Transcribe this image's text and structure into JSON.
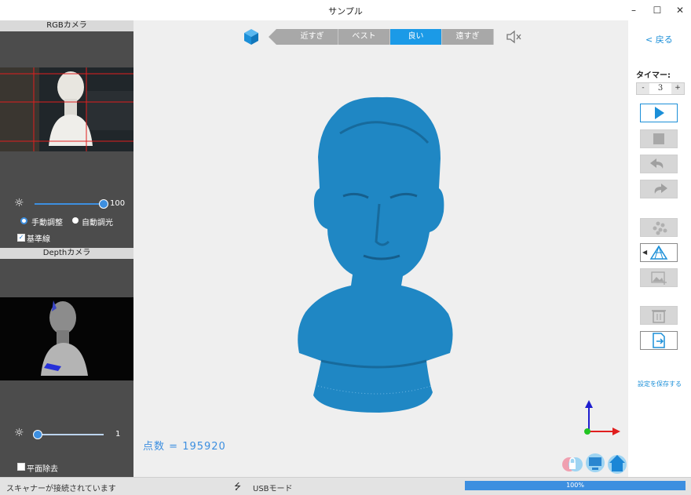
{
  "window": {
    "title": "サンプル",
    "minimize": "–",
    "maximize": "☐",
    "close": "✕"
  },
  "left_panel": {
    "rgb_camera": {
      "header": "RGBカメラ",
      "brightness_value": "100",
      "brightness_fraction": 1.0,
      "manual_adjust_label": "手動調整",
      "auto_light_label": "自動調光",
      "reference_lines_label": "基準線",
      "reference_lines_checked": true
    },
    "depth_camera": {
      "header": "Depthカメラ",
      "brightness_value": "1",
      "brightness_fraction": 0.0,
      "plane_removal_label": "平面除去",
      "plane_removal_checked": false
    }
  },
  "quality_bar": {
    "segments": [
      "近すぎ",
      "ベスト",
      "良い",
      "遠すぎ"
    ],
    "active_index": 2
  },
  "viewport": {
    "point_count_label": "点数",
    "point_count_eq": "=",
    "point_count_value": "195920"
  },
  "right_panel": {
    "back_label": "< 戻る",
    "timer_label": "タイマー:",
    "timer_minus": "-",
    "timer_value": "3",
    "timer_plus": "+",
    "save_settings_label": "設定を保存する"
  },
  "status_bar": {
    "connection_text": "スキャナーが接続されています",
    "usb_mode_text": "USBモード",
    "progress_text": "100%",
    "progress_fraction": 1.0
  },
  "colors": {
    "accent": "#1b9ae7",
    "model": "#1f87c4",
    "panel_dark": "#4c4c4c",
    "viewport_bg": "#efefef",
    "axis_x": "#e01e1e",
    "axis_y": "#1e1ecf",
    "axis_origin": "#22c422"
  }
}
